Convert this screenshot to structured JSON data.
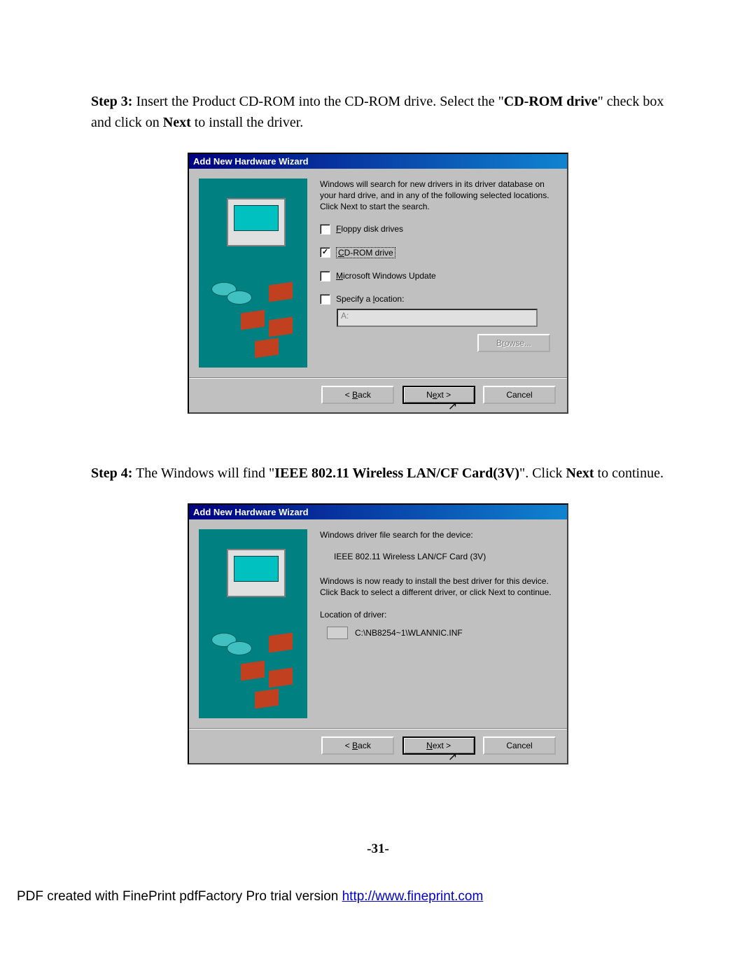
{
  "step3": {
    "label": "Step 3:",
    "text_a": " Insert the Product CD-ROM into the CD-ROM drive.   Select the \"",
    "bold_a": "CD-ROM drive",
    "text_b": "\" check box and click on ",
    "bold_b": "Next",
    "text_c": " to install the driver."
  },
  "step4": {
    "label": "Step 4:",
    "text_a": " The Windows will find \"",
    "bold_a": "IEEE 802.11 Wireless LAN/CF Card(3V)",
    "text_b": "\".   Click ",
    "bold_b": "Next",
    "text_c": " to continue."
  },
  "dialog1": {
    "title": "Add New Hardware Wizard",
    "intro": "Windows will search for new drivers in its driver database on your hard drive, and in any of the following selected locations. Click Next to start the search.",
    "opt_floppy": "Floppy disk drives",
    "opt_cdrom": "CD-ROM drive",
    "opt_winupdate": "Microsoft Windows Update",
    "opt_specify": "Specify a location:",
    "location_value": "A:",
    "browse": "Browse...",
    "back": "< Back",
    "next": "Next >",
    "cancel": "Cancel"
  },
  "dialog2": {
    "title": "Add New Hardware Wizard",
    "intro": "Windows driver file search for the device:",
    "device": "IEEE 802.11 Wireless LAN/CF Card (3V)",
    "ready": "Windows is now ready to install the best driver for this device. Click Back to select a different driver, or click Next to continue.",
    "loc_label": "Location of driver:",
    "loc_path": "C:\\NB8254~1\\WLANNIC.INF",
    "back": "< Back",
    "next": "Next >",
    "cancel": "Cancel"
  },
  "page_num": "-31-",
  "footer": {
    "text": "PDF created with FinePrint pdfFactory Pro trial version ",
    "link": "http://www.fineprint.com"
  }
}
